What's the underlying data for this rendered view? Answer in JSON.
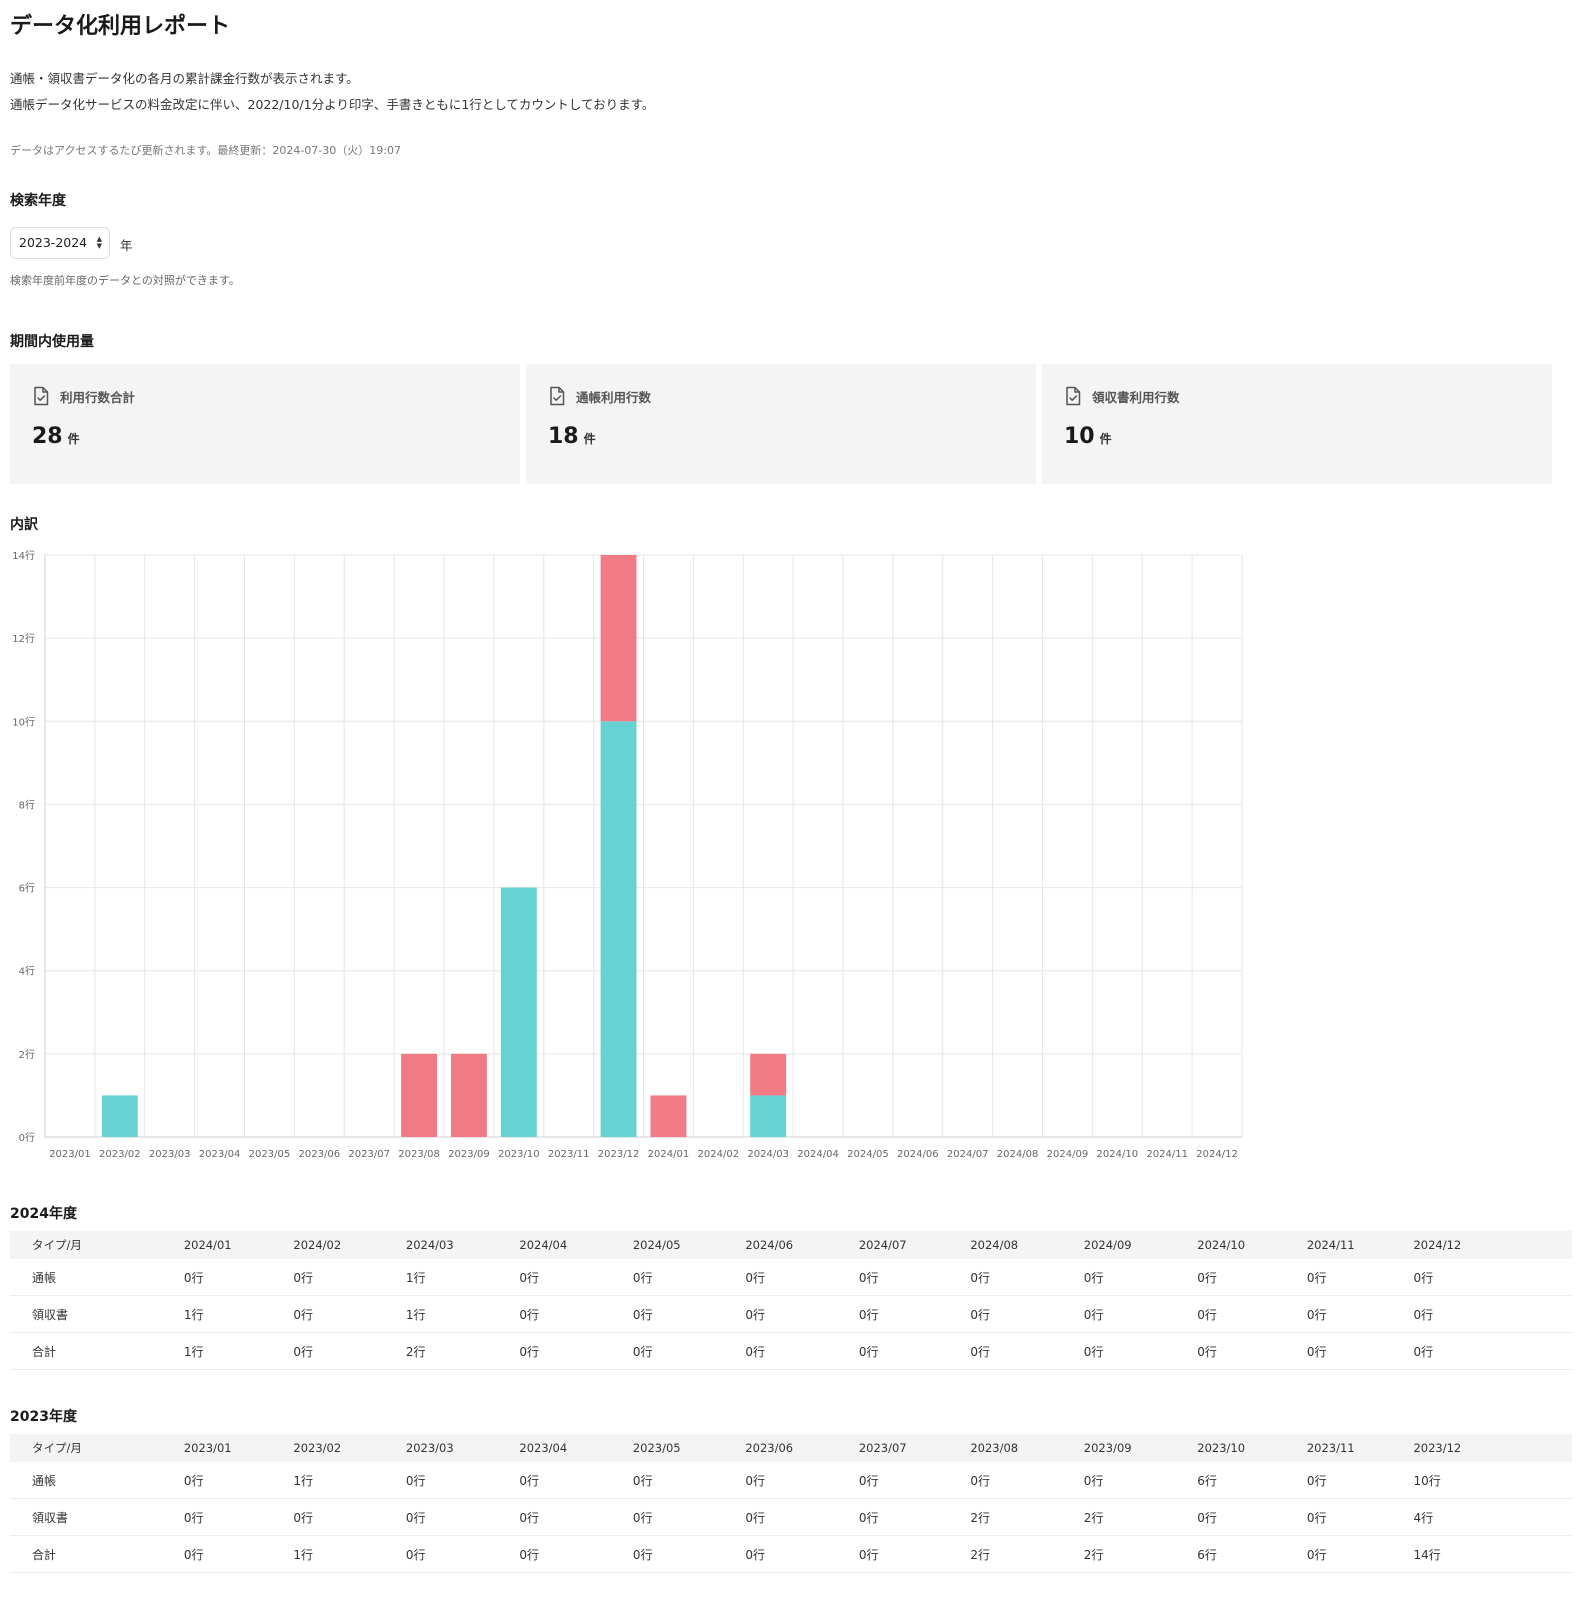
{
  "page": {
    "title": "データ化利用レポート",
    "description_1": "通帳・領収書データ化の各月の累計課金行数が表示されます。",
    "description_2": "通帳データ化サービスの料金改定に伴い、2022/10/1分より印字、手書きともに1行としてカウントしております。",
    "update_note": "データはアクセスするたび更新されます。最終更新：2024-07-30（火）19:07"
  },
  "search": {
    "heading": "検索年度",
    "selected_year": "2023-2024",
    "unit": "年",
    "hint": "検索年度前年度のデータとの対照ができます。"
  },
  "summary": {
    "heading": "期間内使用量",
    "cards": [
      {
        "label": "利用行数合計",
        "value": "28",
        "unit": "件",
        "icon": "document-check-icon"
      },
      {
        "label": "通帳利用行数",
        "value": "18",
        "unit": "件",
        "icon": "document-check-icon"
      },
      {
        "label": "領収書利用行数",
        "value": "10",
        "unit": "件",
        "icon": "document-check-icon"
      }
    ]
  },
  "breakdown": {
    "heading": "内訳"
  },
  "chart_data": {
    "type": "bar",
    "stacked": true,
    "categories": [
      "2023/01",
      "2023/02",
      "2023/03",
      "2023/04",
      "2023/05",
      "2023/06",
      "2023/07",
      "2023/08",
      "2023/09",
      "2023/10",
      "2023/11",
      "2023/12",
      "2024/01",
      "2024/02",
      "2024/03",
      "2024/04",
      "2024/05",
      "2024/06",
      "2024/07",
      "2024/08",
      "2024/09",
      "2024/10",
      "2024/11",
      "2024/12"
    ],
    "series": [
      {
        "color": "#66d2d2",
        "values": [
          0,
          1,
          0,
          0,
          0,
          0,
          0,
          0,
          0,
          6,
          0,
          10,
          0,
          0,
          1,
          0,
          0,
          0,
          0,
          0,
          0,
          0,
          0,
          0
        ]
      },
      {
        "color": "#f07b84",
        "values": [
          0,
          0,
          0,
          0,
          0,
          0,
          0,
          2,
          2,
          0,
          0,
          4,
          1,
          0,
          1,
          0,
          0,
          0,
          0,
          0,
          0,
          0,
          0,
          0
        ]
      }
    ],
    "y_ticks": [
      "0行",
      "2行",
      "4行",
      "6行",
      "8行",
      "10行",
      "12行",
      "14行"
    ],
    "ylim": [
      0,
      14
    ],
    "grid": true,
    "legend": "none"
  },
  "tables": [
    {
      "title": "2024年度",
      "columns": [
        "タイプ/月",
        "2024/01",
        "2024/02",
        "2024/03",
        "2024/04",
        "2024/05",
        "2024/06",
        "2024/07",
        "2024/08",
        "2024/09",
        "2024/10",
        "2024/11",
        "2024/12"
      ],
      "rows": [
        [
          "通帳",
          "0行",
          "0行",
          "1行",
          "0行",
          "0行",
          "0行",
          "0行",
          "0行",
          "0行",
          "0行",
          "0行",
          "0行"
        ],
        [
          "領収書",
          "1行",
          "0行",
          "1行",
          "0行",
          "0行",
          "0行",
          "0行",
          "0行",
          "0行",
          "0行",
          "0行",
          "0行"
        ],
        [
          "合計",
          "1行",
          "0行",
          "2行",
          "0行",
          "0行",
          "0行",
          "0行",
          "0行",
          "0行",
          "0行",
          "0行",
          "0行"
        ]
      ]
    },
    {
      "title": "2023年度",
      "columns": [
        "タイプ/月",
        "2023/01",
        "2023/02",
        "2023/03",
        "2023/04",
        "2023/05",
        "2023/06",
        "2023/07",
        "2023/08",
        "2023/09",
        "2023/10",
        "2023/11",
        "2023/12"
      ],
      "rows": [
        [
          "通帳",
          "0行",
          "1行",
          "0行",
          "0行",
          "0行",
          "0行",
          "0行",
          "0行",
          "0行",
          "6行",
          "0行",
          "10行"
        ],
        [
          "領収書",
          "0行",
          "0行",
          "0行",
          "0行",
          "0行",
          "0行",
          "0行",
          "2行",
          "2行",
          "0行",
          "0行",
          "4行"
        ],
        [
          "合計",
          "0行",
          "1行",
          "0行",
          "0行",
          "0行",
          "0行",
          "0行",
          "2行",
          "2行",
          "6行",
          "0行",
          "14行"
        ]
      ]
    }
  ]
}
